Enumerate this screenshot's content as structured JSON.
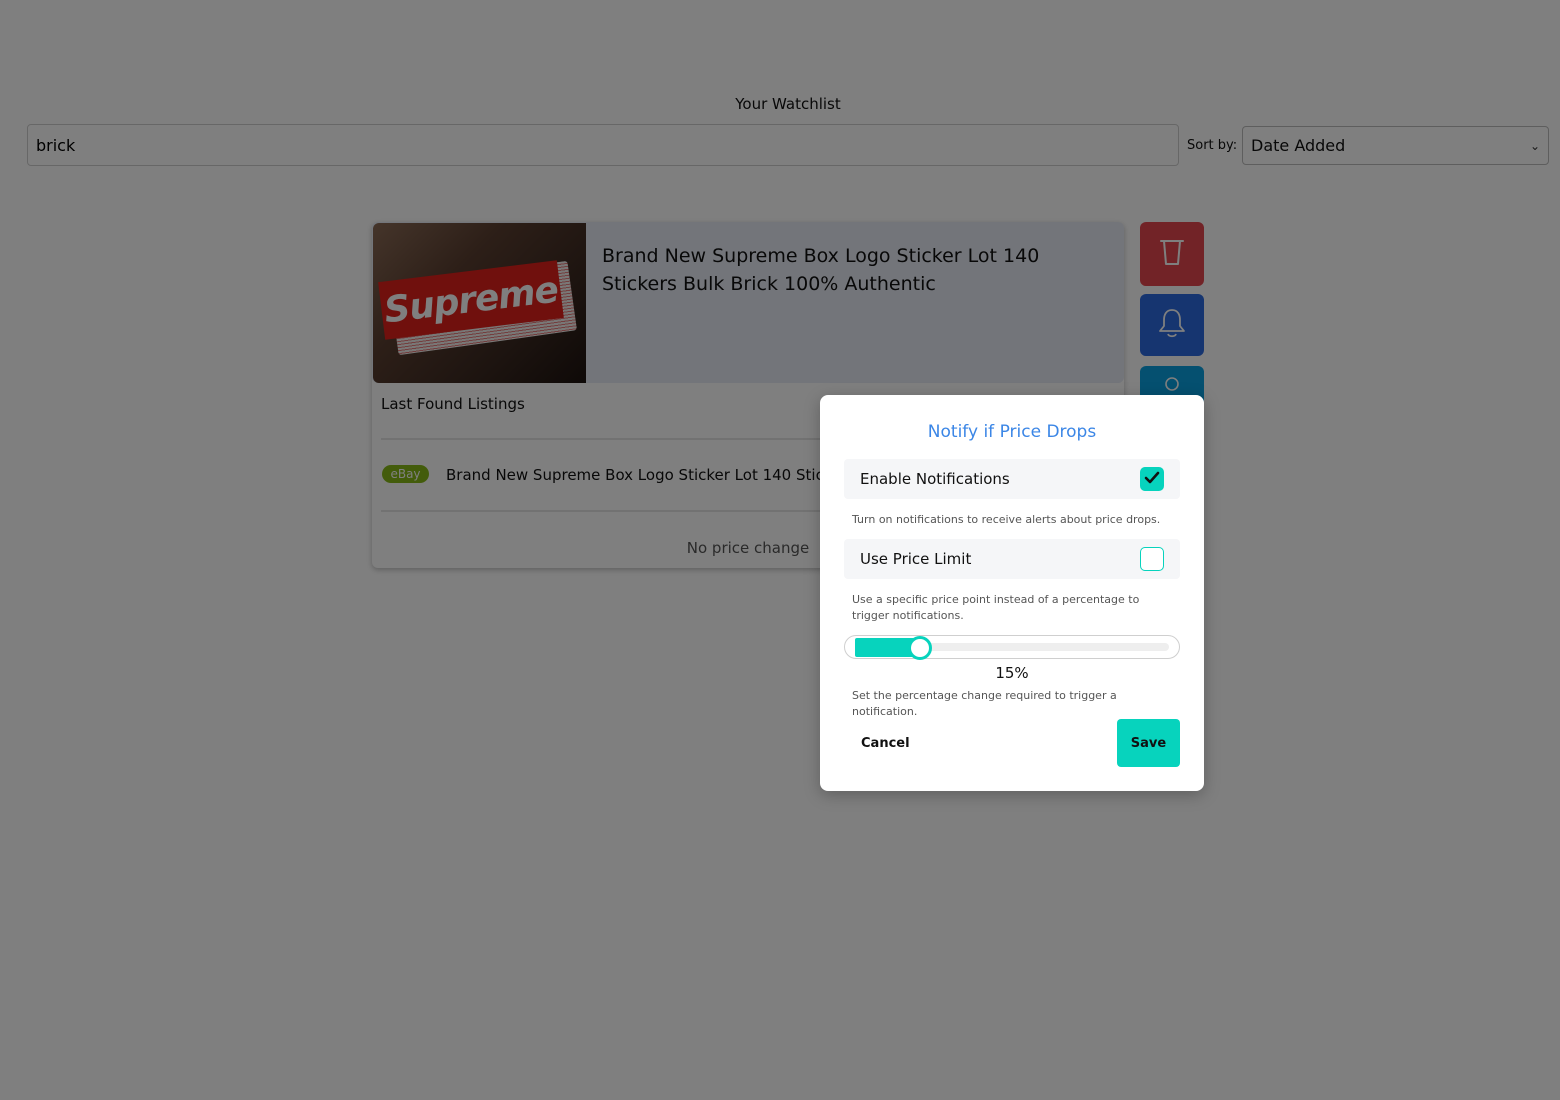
{
  "watchlist": {
    "title": "Your Watchlist",
    "search_value": "brick",
    "sort_label": "Sort by:",
    "sort_selected": "Date Added"
  },
  "item": {
    "title": "Brand New Supreme Box Logo Sticker Lot 140 Stickers Bulk Brick 100% Authentic",
    "image_text": "Supreme",
    "last_found_label": "Last Found Listings",
    "listing": {
      "source": "eBay",
      "title": "Brand New Supreme Box Logo Sticker Lot 140 Stickers Bulk Brick 100% Authentic"
    },
    "price_status": "No price change"
  },
  "side_actions": {
    "delete_icon": "trash-icon",
    "notify_icon": "bell-icon",
    "third_icon": "gear-icon",
    "colors": {
      "delete": "#e4474f",
      "notify": "#2d6be0",
      "third": "#0aa1e0"
    }
  },
  "modal": {
    "title": "Notify if Price Drops",
    "enable": {
      "label": "Enable Notifications",
      "checked": true,
      "help": "Turn on notifications to receive alerts about price drops."
    },
    "price_limit": {
      "label": "Use Price Limit",
      "checked": false,
      "help": "Use a specific price point instead of a percentage to trigger notifications."
    },
    "slider": {
      "value": 15,
      "value_text": "15%",
      "help": "Set the percentage change required to trigger a notification."
    },
    "cancel_label": "Cancel",
    "save_label": "Save",
    "accent_color": "#07d3bd",
    "title_color": "#3b86e6"
  }
}
